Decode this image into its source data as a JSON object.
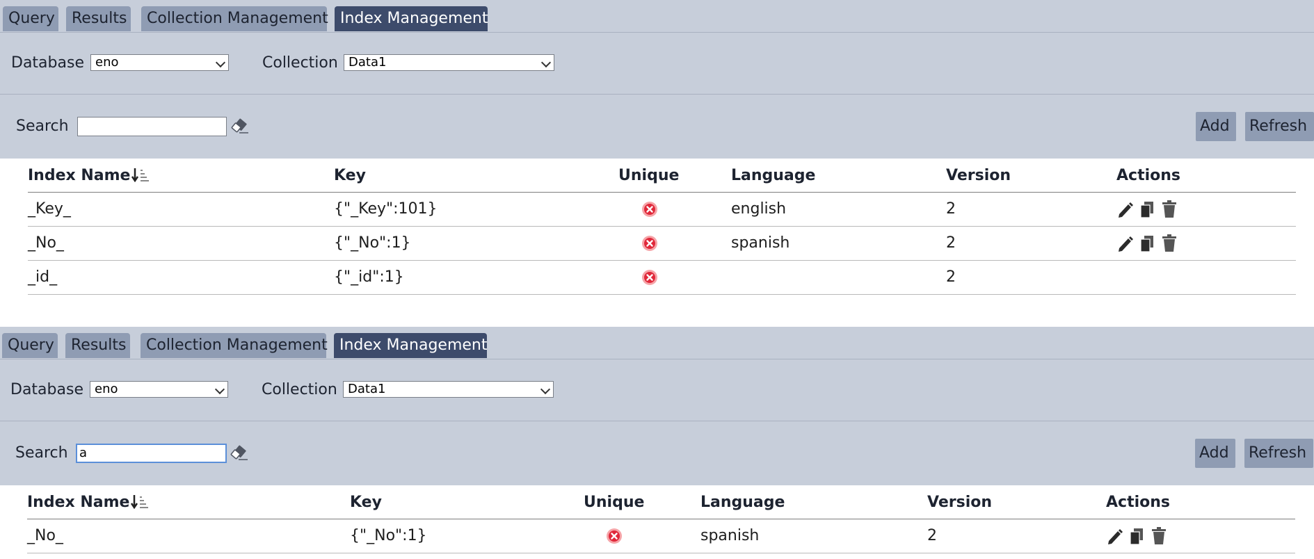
{
  "tabs": [
    "Query",
    "Results",
    "Collection Management",
    "Index Management"
  ],
  "labels": {
    "database": "Database",
    "collection": "Collection",
    "search": "Search"
  },
  "buttons": {
    "add": "Add",
    "refresh": "Refresh"
  },
  "columns": [
    "Index Name",
    "Key",
    "Unique",
    "Language",
    "Version",
    "Actions"
  ],
  "colors": {
    "chrome": "#c7ceda",
    "tab": "#8f9cb3",
    "active_tab": "#3d4b6b",
    "unique_false": "#e0283a"
  },
  "icons": [
    "sort-desc-icon",
    "eraser-icon",
    "not-unique-icon",
    "edit-icon",
    "copy-icon",
    "delete-icon"
  ],
  "panels": [
    {
      "active_tab": "Index Management",
      "database": "eno",
      "collection": "Data1",
      "search": "",
      "rows": [
        {
          "name": "_Key_",
          "key": "{\"_Key\":101}",
          "unique": false,
          "language": "english",
          "version": "2",
          "editable": true
        },
        {
          "name": "_No_",
          "key": "{\"_No\":1}",
          "unique": false,
          "language": "spanish",
          "version": "2",
          "editable": true
        },
        {
          "name": "_id_",
          "key": "{\"_id\":1}",
          "unique": false,
          "language": "",
          "version": "2",
          "editable": false
        }
      ]
    },
    {
      "active_tab": "Index Management",
      "database": "eno",
      "collection": "Data1",
      "search": "a",
      "rows": [
        {
          "name": "_No_",
          "key": "{\"_No\":1}",
          "unique": false,
          "language": "spanish",
          "version": "2",
          "editable": true
        }
      ]
    }
  ]
}
